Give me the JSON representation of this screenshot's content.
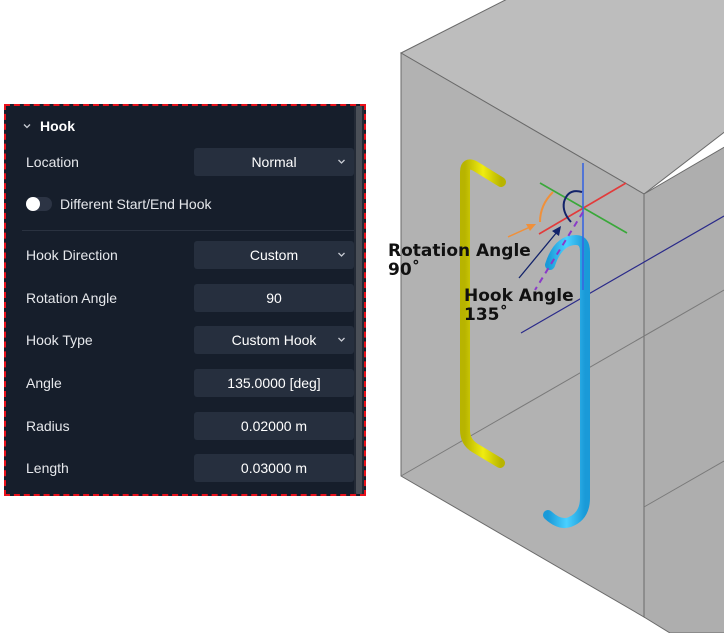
{
  "panel": {
    "section_title": "Hook",
    "section_icon": "chevron-down-icon",
    "rows": [
      {
        "label": "Location",
        "type": "select",
        "value": "Normal"
      },
      {
        "label": "Different Start/End Hook",
        "type": "toggle",
        "checked": false
      },
      {
        "label": "Hook Direction",
        "type": "select",
        "value": "Custom"
      },
      {
        "label": "Rotation Angle",
        "type": "input",
        "value": "90"
      },
      {
        "label": "Hook Type",
        "type": "select",
        "value": "Custom Hook"
      },
      {
        "label": "Angle",
        "type": "input",
        "value": "135.0000 [deg]"
      },
      {
        "label": "Radius",
        "type": "input",
        "value": "0.02000 m"
      },
      {
        "label": "Length",
        "type": "input",
        "value": "0.03000 m"
      }
    ]
  },
  "viewport": {
    "annotations": {
      "rotation_angle_label": "Rotation Angle",
      "rotation_angle_value": "90˚",
      "hook_angle_label": "Hook Angle",
      "hook_angle_value": "135˚"
    },
    "colors": {
      "concrete": "#b4b4b4",
      "rebar_yellow": "#d8d400",
      "rebar_cyan": "#2cb8ee",
      "axis_x": "#e23b3b",
      "axis_y": "#3aa83a",
      "axis_z": "#3a66e0",
      "rotation_arc": "#f0903a",
      "hook_arc": "#12226a",
      "hook_dash": "#8a3ac8"
    }
  }
}
